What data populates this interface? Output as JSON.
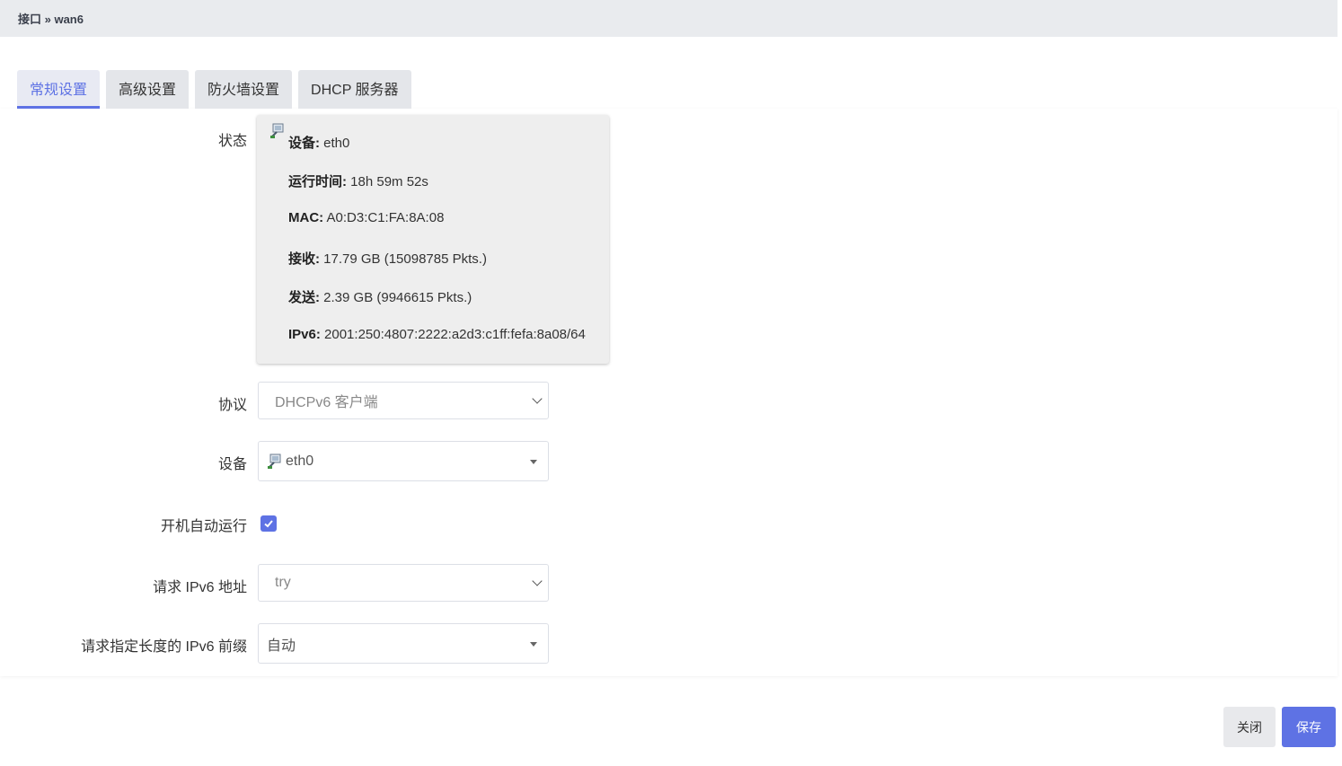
{
  "breadcrumb": "接口 » wan6",
  "tabs": [
    {
      "label": "常规设置",
      "active": true
    },
    {
      "label": "高级设置",
      "active": false
    },
    {
      "label": "防火墙设置",
      "active": false
    },
    {
      "label": "DHCP 服务器",
      "active": false
    }
  ],
  "labels": {
    "status": "状态",
    "protocol": "协议",
    "device": "设备",
    "autostart": "开机自动运行",
    "request_ipv6_addr": "请求 IPv6 地址",
    "request_ipv6_prefix": "请求指定长度的 IPv6 前缀"
  },
  "status": {
    "device_key": "设备:",
    "device_val": "eth0",
    "uptime_key": "运行时间:",
    "uptime_val": "18h 59m 52s",
    "mac_key": "MAC:",
    "mac_val": "A0:D3:C1:FA:8A:08",
    "rx_key": "接收:",
    "rx_val": "17.79 GB (15098785 Pkts.)",
    "tx_key": "发送:",
    "tx_val": "2.39 GB (9946615 Pkts.)",
    "ipv6_key": "IPv6:",
    "ipv6_val": "2001:250:4807:2222:a2d3:c1ff:fefa:8a08/64"
  },
  "fields": {
    "protocol_value": "DHCPv6 客户端",
    "device_value": "eth0",
    "autostart_checked": true,
    "request_ipv6_addr_value": "try",
    "request_ipv6_prefix_value": "自动"
  },
  "buttons": {
    "close": "关闭",
    "save": "保存"
  },
  "colors": {
    "accent": "#5e72e4"
  }
}
